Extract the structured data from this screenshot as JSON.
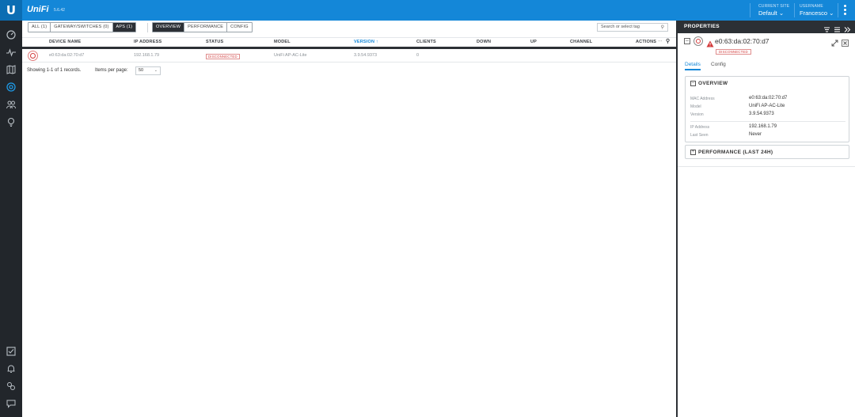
{
  "topbar": {
    "brand": "UniFi",
    "version": "5.6.42",
    "site_label": "CURRENT SITE",
    "site_value": "Default",
    "user_label": "USERNAME",
    "user_value": "Francesco",
    "bg_color": "#1487d8"
  },
  "sidebar": {
    "items": [
      {
        "icon": "dashboard-icon"
      },
      {
        "icon": "statistics-icon"
      },
      {
        "icon": "map-icon"
      },
      {
        "icon": "devices-icon",
        "active": true
      },
      {
        "icon": "clients-icon"
      },
      {
        "icon": "insights-icon"
      }
    ],
    "bottom_items": [
      {
        "icon": "events-icon"
      },
      {
        "icon": "alerts-icon"
      },
      {
        "icon": "settings-icon"
      },
      {
        "icon": "chat-icon"
      }
    ]
  },
  "filters": {
    "all": "ALL (1)",
    "gateway": "GATEWAY/SWITCHES (0)",
    "aps": "APS (1)"
  },
  "views": {
    "overview": "OVERVIEW",
    "performance": "PERFORMANCE",
    "config": "CONFIG"
  },
  "search": {
    "placeholder": "Search or select tag"
  },
  "table": {
    "columns": {
      "device_name": "DEVICE NAME",
      "ip": "IP ADDRESS",
      "status": "STATUS",
      "model": "MODEL",
      "version": "VERSION",
      "clients": "CLIENTS",
      "down": "DOWN",
      "up": "UP",
      "channel": "CHANNEL",
      "actions": "ACTIONS"
    },
    "rows": [
      {
        "device_name": "e0:63:da:02:70:d7",
        "ip": "192.168.1.79",
        "status": "DISCONNECTED",
        "model": "UniFi AP-AC-Lite",
        "version": "3.9.54.9373",
        "clients": "0"
      }
    ]
  },
  "footer": {
    "records": "Showing 1-1 of 1 records.",
    "items_per_page_label": "Items per page:",
    "items_per_page_value": "50"
  },
  "panel": {
    "title": "PROPERTIES",
    "device_name": "e0:63:da:02:70:d7",
    "status": "DISCONNECTED",
    "tabs": {
      "details": "Details",
      "config": "Config"
    },
    "overview": {
      "title": "OVERVIEW",
      "mac_label": "MAC Address",
      "mac_value": "e0:63:da:02:70:d7",
      "model_label": "Model",
      "model_value": "UniFi AP-AC-Lite",
      "version_label": "Version",
      "version_value": "3.9.54.9373",
      "ip_label": "IP Address",
      "ip_value": "192.168.1.79",
      "last_seen_label": "Last Seen",
      "last_seen_value": "Never"
    },
    "performance": {
      "title": "PERFORMANCE (LAST 24H)"
    }
  },
  "colors": {
    "accent": "#1487d8",
    "error": "#d33a3a",
    "dark": "#2c3035"
  }
}
